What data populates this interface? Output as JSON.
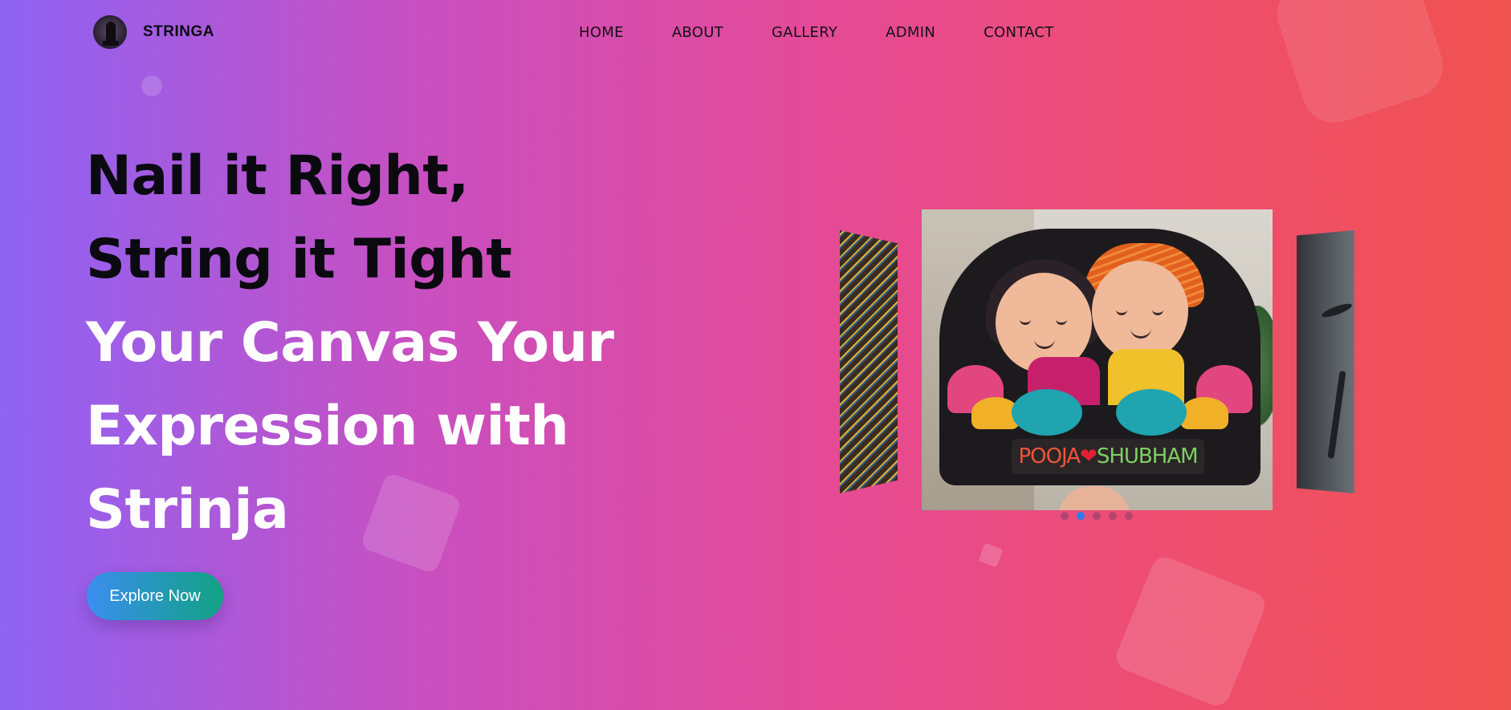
{
  "header": {
    "brand": "STRINGA",
    "nav": [
      "HOME",
      "ABOUT",
      "GALLERY",
      "ADMIN",
      "CONTACT"
    ]
  },
  "hero": {
    "line1": "Nail it Right,",
    "line2": "String it Tight",
    "line3": "Your Canvas Your",
    "line4": "Expression with",
    "line5": "Strinja",
    "cta": "Explore Now"
  },
  "carousel": {
    "slide_count": 5,
    "active_index": 1,
    "main_slide": {
      "nameplate_left": "POOJA",
      "nameplate_heart": "❤",
      "nameplate_right": "SHUBHAM"
    }
  },
  "colors": {
    "bg_start": "#8e63f4",
    "bg_end": "#f05250",
    "cta_start": "#3b8ef0",
    "cta_end": "#11a283",
    "dot_active": "#2f7be8"
  }
}
